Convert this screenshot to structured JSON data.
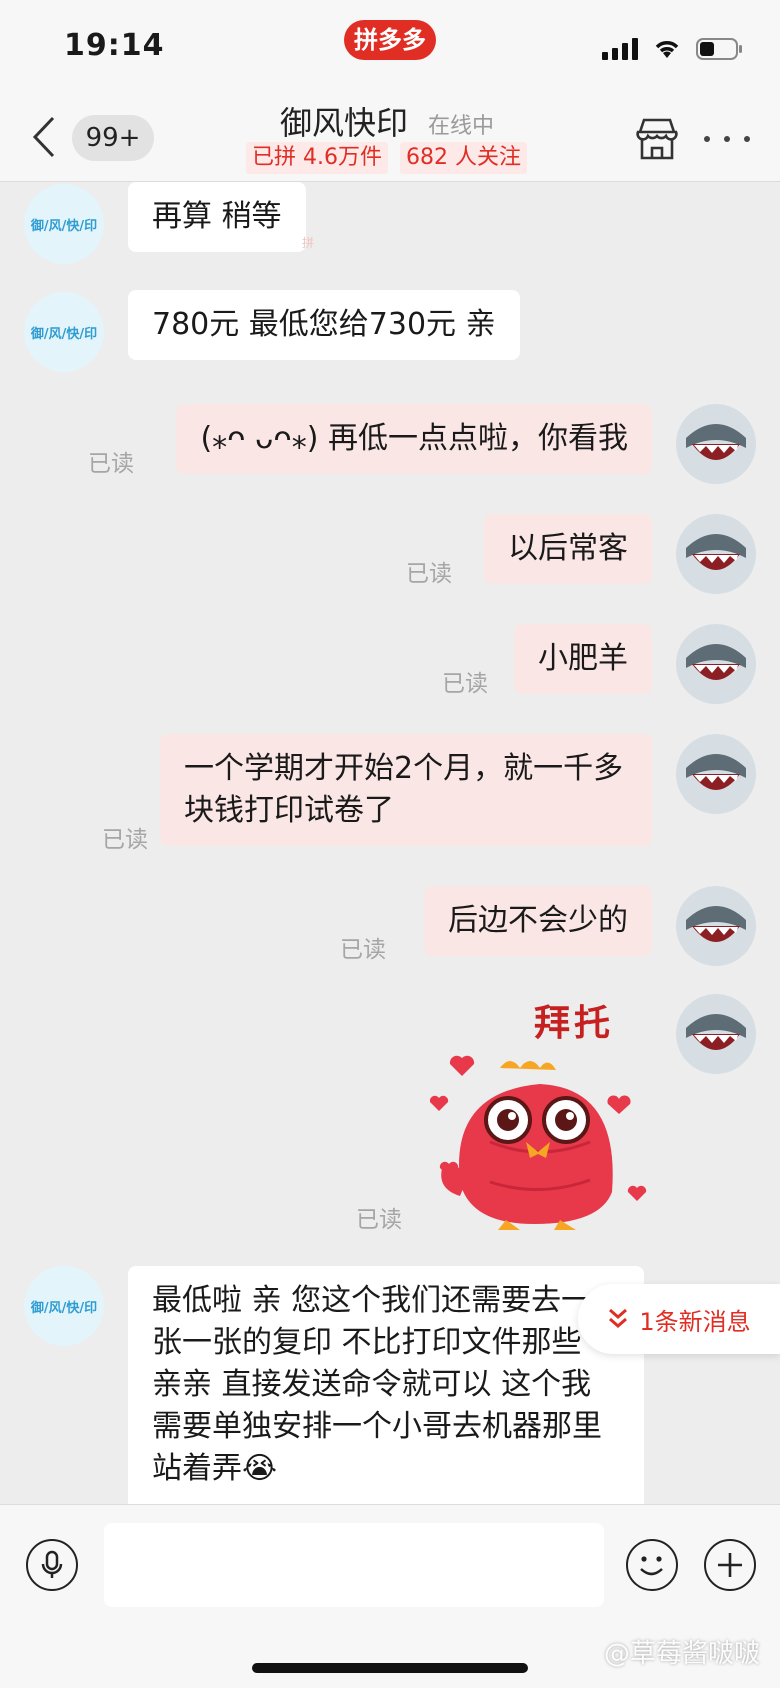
{
  "status_bar": {
    "time": "19:14",
    "app_badge": "拼多多"
  },
  "header": {
    "unread_count": "99+",
    "shop_name": "御风快印",
    "online_status": "在线中",
    "sold_stat": "已拼 4.6万件",
    "follow_stat": "682 人关注",
    "icons": [
      "back-arrow-icon",
      "store-icon",
      "more-icon"
    ]
  },
  "shop_avatar_text": "御/风/快/印",
  "read_label": "已读",
  "pdd_mark": "拼",
  "messages": [
    {
      "side": "in",
      "text": "再算 稍等"
    },
    {
      "side": "in",
      "text": "780元 最低您给730元 亲"
    },
    {
      "side": "out",
      "text": "(⁎ᴖ ᴗᴖ⁎) 再低一点点啦，你看我",
      "read": true
    },
    {
      "side": "out",
      "text": "以后常客",
      "read": true
    },
    {
      "side": "out",
      "text": "小肥羊",
      "read": true
    },
    {
      "side": "out",
      "text": "一个学期才开始2个月，就一千多块钱打印试卷了",
      "read": true
    },
    {
      "side": "out",
      "text": "后边不会少的",
      "read": true
    },
    {
      "side": "out",
      "type": "sticker",
      "caption": "拜托",
      "read": true
    },
    {
      "side": "in",
      "text": "最低啦 亲 您这个我们还需要去一张一张的复印 不比打印文件那些 亲亲 直接发送命令就可以 这个我需要单独安排一个小哥去机器那里站着弄😭"
    }
  ],
  "new_message_notice": "1条新消息",
  "input": {
    "placeholder": ""
  },
  "watermark": "@草莓酱啵啵",
  "colors": {
    "brand_red": "#e02e24",
    "outgoing_bubble": "#fbe6e6",
    "incoming_bubble": "#ffffff",
    "chat_background": "#ededed"
  }
}
